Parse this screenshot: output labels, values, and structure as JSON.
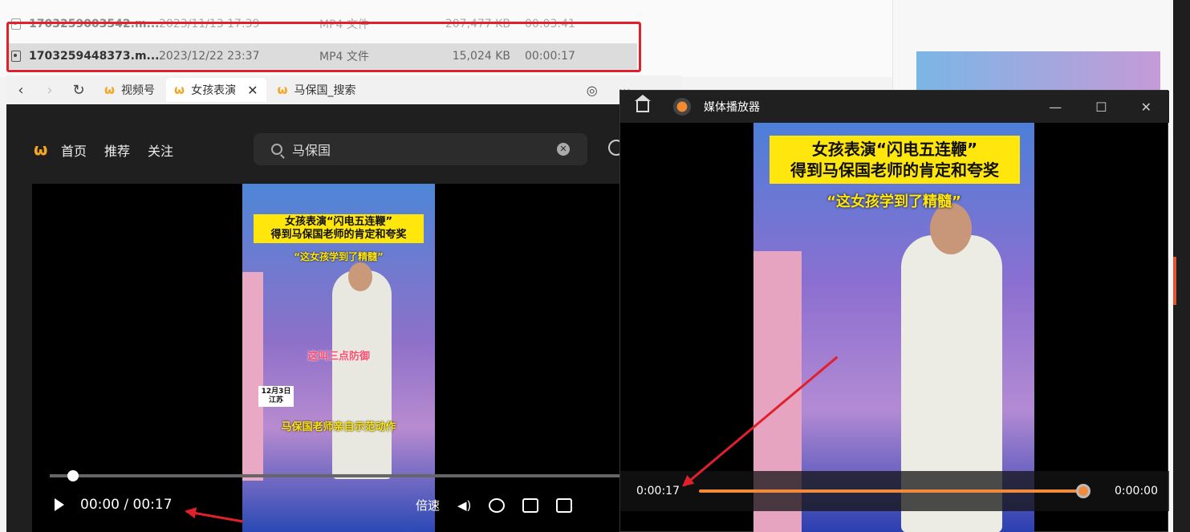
{
  "explorer": {
    "files": [
      {
        "name": "1703259003542.m...",
        "date": "2023/11/13 17:39",
        "type": "MP4 文件",
        "size": "207,477 KB",
        "duration": "00:03:41"
      },
      {
        "name": "1703259448373.m...",
        "date": "2023/12/22 23:37",
        "type": "MP4 文件",
        "size": "15,024 KB",
        "duration": "00:00:17"
      }
    ]
  },
  "browser": {
    "tabs": [
      {
        "label": "视频号"
      },
      {
        "label": "女孩表演"
      },
      {
        "label": "马保国_搜索"
      }
    ],
    "nav": {
      "home": "首页",
      "recommend": "推荐",
      "follow": "关注"
    },
    "search": {
      "value": "马保国"
    },
    "video": {
      "caption_line1": "女孩表演“闪电五连鞭”",
      "caption_line2": "得到马保国老师的肯定和夸奖",
      "quote": "“这女孩学到了精髓”",
      "pink_text": "这叫三点防御",
      "date_line1": "12月3日",
      "date_line2": "江苏",
      "yellow_text": "马保国老师亲自示范动作"
    },
    "controls": {
      "time": "00:00 / 00:17",
      "speed": "倍速"
    }
  },
  "media_player": {
    "title": "媒体播放器",
    "caption_line1": "女孩表演“闪电五连鞭”",
    "caption_line2": "得到马保国老师的肯定和夸奖",
    "quote": "“这女孩学到了精髓”",
    "current_time": "0:00:17",
    "total_time": "0:00:00",
    "progress": 1.0
  },
  "colors": {
    "accent": "#f08a3c",
    "highlight": "#e0202a",
    "caption": "#ffe60d"
  }
}
